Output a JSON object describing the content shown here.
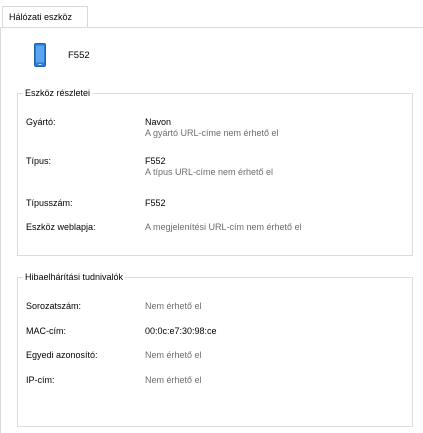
{
  "tab": {
    "label": "Hálózati eszköz"
  },
  "device": {
    "name": "F552",
    "icon": "phone-icon"
  },
  "details": {
    "title": "Eszköz részletei",
    "manufacturer_label": "Gyártó:",
    "manufacturer_value": "Navon",
    "manufacturer_sub": "A gyártó URL-címe nem érhető el",
    "type_label": "Típus:",
    "type_value": "F552",
    "type_sub": "A típus URL-címe nem érhető el",
    "model_number_label": "Típusszám:",
    "model_number_value": "F552",
    "web_page_label": "Eszköz weblapja:",
    "web_page_value": "A megjelenítési URL-cím nem érhető el"
  },
  "troubleshooting": {
    "title": "Hibaelhárítási tudnivalók",
    "serial_label": "Sorozatszám:",
    "serial_value": "Nem érhető el",
    "mac_label": "MAC-cím:",
    "mac_value": "00:0c:e7:30:98:ce",
    "uid_label": "Egyedi azonosító:",
    "uid_value": "Nem érhető el",
    "ip_label": "IP-cím:",
    "ip_value": "Nem érhető el"
  },
  "colors": {
    "accent": "#2b7ed6",
    "border": "#dcdcdc",
    "muted_text": "#6d6d6d"
  }
}
